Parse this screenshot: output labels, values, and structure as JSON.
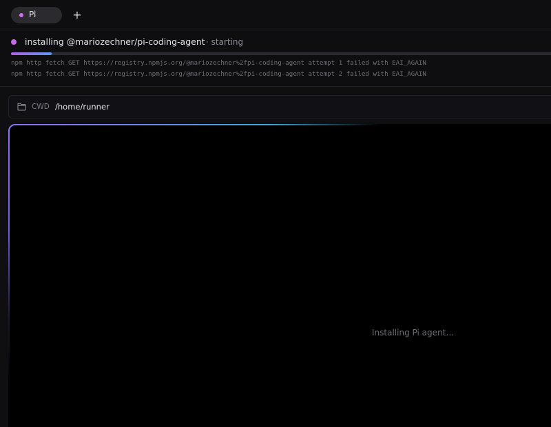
{
  "tabs": [
    {
      "label": "Pi",
      "active": true,
      "dot_color": "#d070f0"
    }
  ],
  "tabbar": {
    "add_label": "+"
  },
  "install": {
    "title": "installing @mariozechner/pi-coding-agent",
    "state": "· starting",
    "progress": 0.075,
    "accent": "#c86ae6",
    "log": [
      "npm http fetch GET https://registry.npmjs.org/@mariozechner%2fpi-coding-agent attempt 1 failed with EAI_AGAIN",
      "npm http fetch GET https://registry.npmjs.org/@mariozechner%2fpi-coding-agent attempt 2 failed with EAI_AGAIN"
    ]
  },
  "cwd": {
    "icon": "folder-icon",
    "label": "CWD",
    "path": "/home/runner"
  },
  "terminal": {
    "message": "Installing Pi agent…"
  }
}
